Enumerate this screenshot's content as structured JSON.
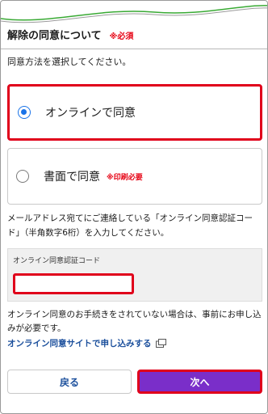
{
  "header": {
    "title": "解除の同意について",
    "required": "※必須"
  },
  "instruction": "同意方法を選択してください。",
  "options": [
    {
      "label": "オンラインで同意",
      "selected": true
    },
    {
      "label": "書面で同意",
      "note": "※印刷必要",
      "selected": false
    }
  ],
  "description": "メールアドレス宛てにご連絡している「オンライン同意認証コード」（半角数字6桁）を入力してください。",
  "code_field": {
    "label": "オンライン同意認証コード",
    "value": "",
    "placeholder": ""
  },
  "note": "オンライン同意のお手続きをされていない場合は、事前にお申し込みが必要です。",
  "link": {
    "label": "オンライン同意サイトで申し込みする",
    "icon": "external-window-icon"
  },
  "buttons": {
    "back": "戻る",
    "next": "次へ"
  },
  "colors": {
    "required_red": "#e60012",
    "highlight_red": "#e0001b",
    "radio_blue": "#1a73e8",
    "link_blue": "#1b4f9c",
    "next_purple": "#7a2ec9",
    "wave_green": "#3aaa35"
  }
}
